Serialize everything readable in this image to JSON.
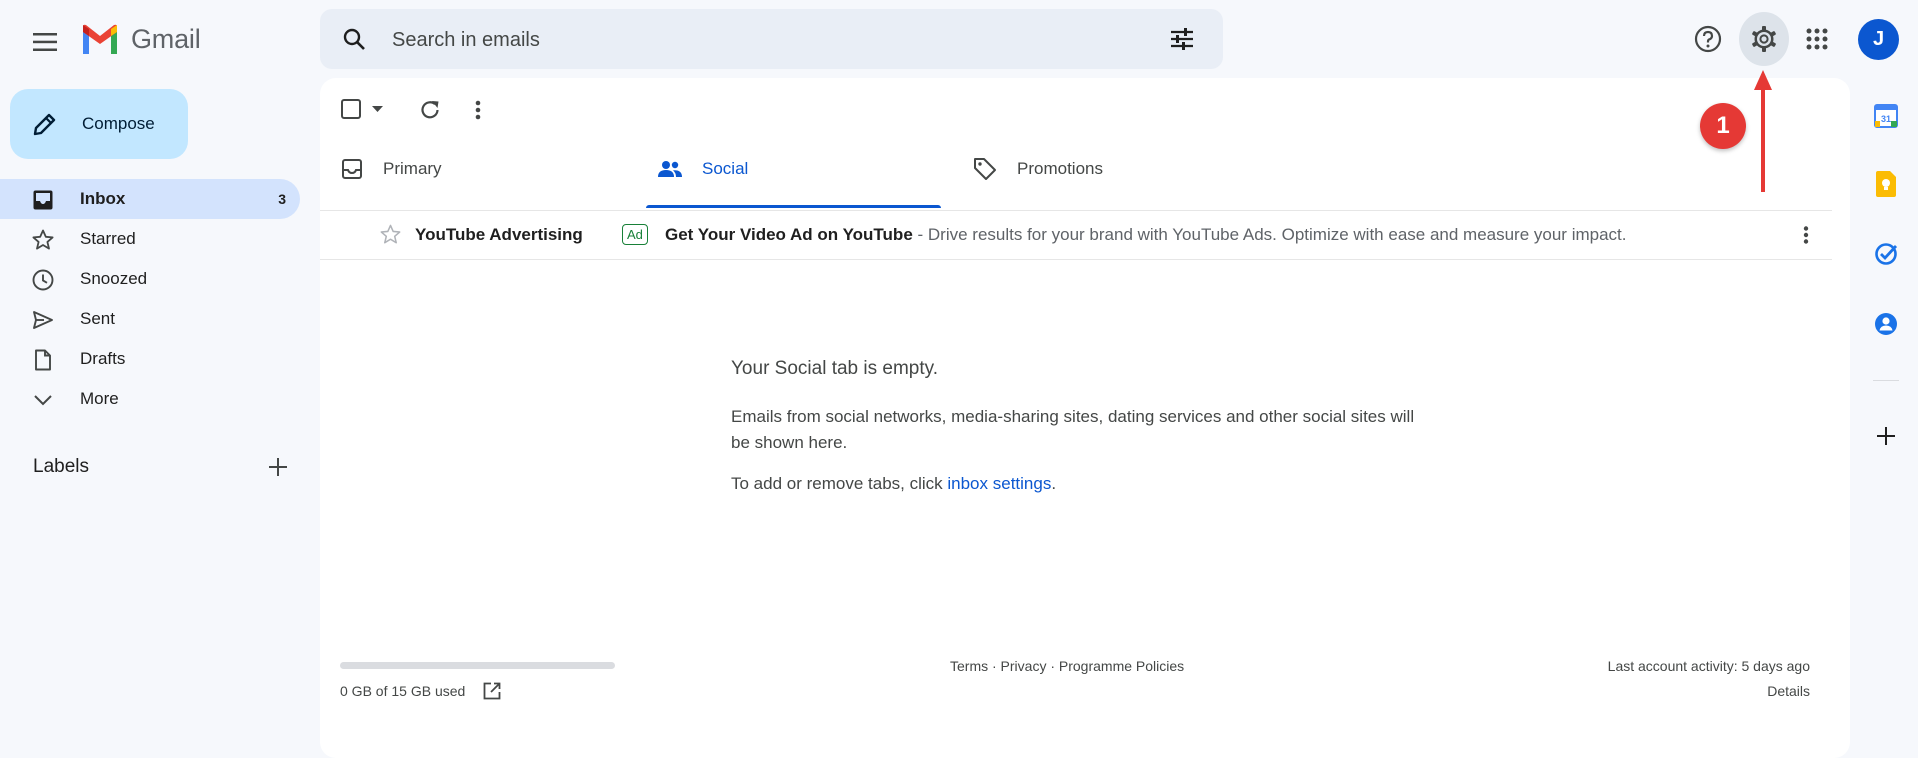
{
  "header": {
    "logo_text": "Gmail",
    "search_placeholder": "Search in emails",
    "avatar_letter": "J",
    "avatar_color": "#0b57d0"
  },
  "sidebar": {
    "compose_label": "Compose",
    "items": [
      {
        "label": "Inbox",
        "count": "3",
        "icon": "inbox-icon",
        "active": true
      },
      {
        "label": "Starred",
        "icon": "star-icon"
      },
      {
        "label": "Snoozed",
        "icon": "clock-icon"
      },
      {
        "label": "Sent",
        "icon": "send-icon"
      },
      {
        "label": "Drafts",
        "icon": "draft-icon"
      },
      {
        "label": "More",
        "icon": "chevron-down-icon"
      }
    ],
    "labels_heading": "Labels"
  },
  "tabs": [
    {
      "label": "Primary",
      "icon": "inbox-icon"
    },
    {
      "label": "Social",
      "icon": "people-icon",
      "active": true
    },
    {
      "label": "Promotions",
      "icon": "tag-icon"
    }
  ],
  "email": {
    "sender": "YouTube Advertising",
    "badge": "Ad",
    "subject": "Get Your Video Ad on YouTube",
    "snippet": " - Drive results for your brand with YouTube Ads. Optimize with ease and measure your impact."
  },
  "empty_state": {
    "title": "Your Social tab is empty.",
    "body": "Emails from social networks, media-sharing sites, dating services and other social sites will be shown here.",
    "settings_prefix": "To add or remove tabs, click ",
    "settings_link": "inbox settings",
    "settings_suffix": "."
  },
  "footer": {
    "storage_text": "0 GB of 15 GB used",
    "storage_used_fraction": 0,
    "links": "Terms · Privacy · Programme Policies",
    "activity": "Last account activity: 5 days ago",
    "details": "Details"
  },
  "annotation": {
    "step_number": "1",
    "color": "#e53935"
  }
}
